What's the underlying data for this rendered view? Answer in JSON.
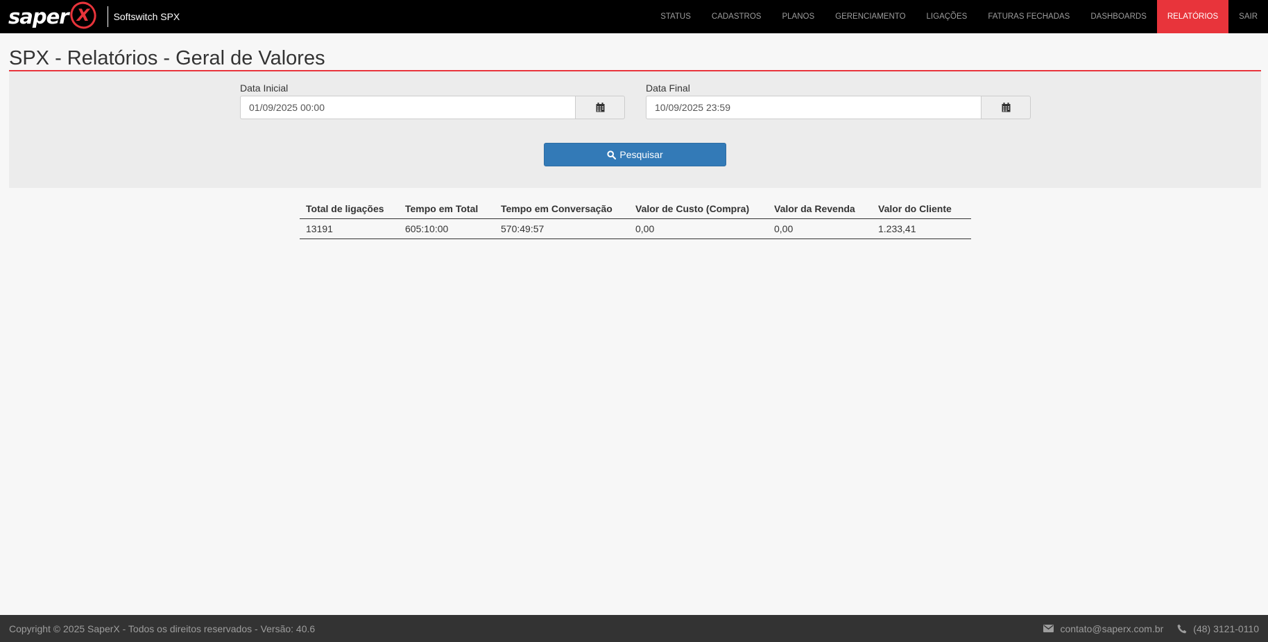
{
  "brand": {
    "logo_text": "saper",
    "logo_mark": "X",
    "app_name": "Softswitch SPX"
  },
  "nav": {
    "items": [
      {
        "label": "STATUS"
      },
      {
        "label": "CADASTROS"
      },
      {
        "label": "PLANOS"
      },
      {
        "label": "GERENCIAMENTO"
      },
      {
        "label": "LIGAÇÕES"
      },
      {
        "label": "FATURAS FECHADAS"
      },
      {
        "label": "DASHBOARDS"
      },
      {
        "label": "RELATÓRIOS"
      },
      {
        "label": "SAIR"
      }
    ],
    "active": "RELATÓRIOS",
    "active_color": "#e8343b"
  },
  "page": {
    "title": "SPX - Relatórios - Geral de Valores"
  },
  "filters": {
    "start_label": "Data Inicial",
    "start_value": "01/09/2025 00:00",
    "end_label": "Data Final",
    "end_value": "10/09/2025 23:59",
    "calendar_icon": "calendar-icon",
    "search_icon": "search-icon",
    "search_button": "Pesquisar",
    "search_button_color": "#337ab7"
  },
  "table": {
    "headers": [
      "Total de ligações",
      "Tempo em Total",
      "Tempo em Conversação",
      "Valor de Custo (Compra)",
      "Valor da Revenda",
      "Valor do Cliente"
    ],
    "rows": [
      [
        "13191",
        "605:10:00",
        "570:49:57",
        "0,00",
        "0,00",
        "1.233,41"
      ]
    ]
  },
  "footer": {
    "copyright": "Copyright © 2025 SaperX - Todos os direitos reservados - Versão: 40.6",
    "email_icon": "envelope-icon",
    "email": "contato@saperx.com.br",
    "phone_icon": "phone-icon",
    "phone": "(48) 3121-0110"
  }
}
